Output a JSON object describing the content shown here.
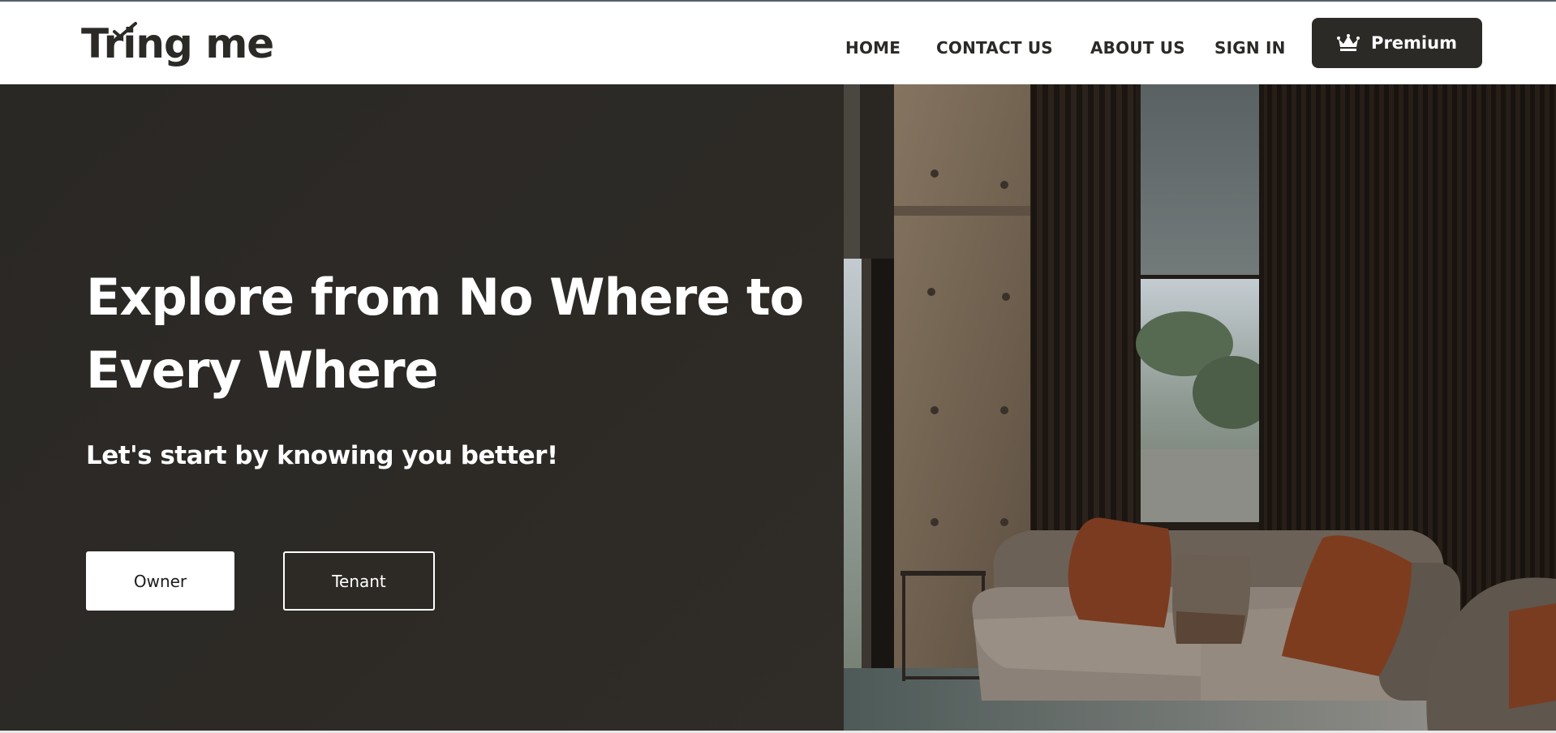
{
  "header": {
    "logo_text": "Tring me",
    "nav": {
      "home": "HOME",
      "contact": "CONTACT US",
      "about": "ABOUT US",
      "signin": "SIGN IN"
    },
    "premium_label": "Premium",
    "premium_icon": "crown-icon"
  },
  "hero": {
    "title_line1": "Explore from No Where to",
    "title_line2": "Every Where",
    "subtitle": "Let's start by knowing you better!",
    "owner_label": "Owner",
    "tenant_label": "Tenant"
  },
  "colors": {
    "dark": "#2c2a27",
    "hero_bg": "#2d2a26",
    "white": "#ffffff"
  }
}
